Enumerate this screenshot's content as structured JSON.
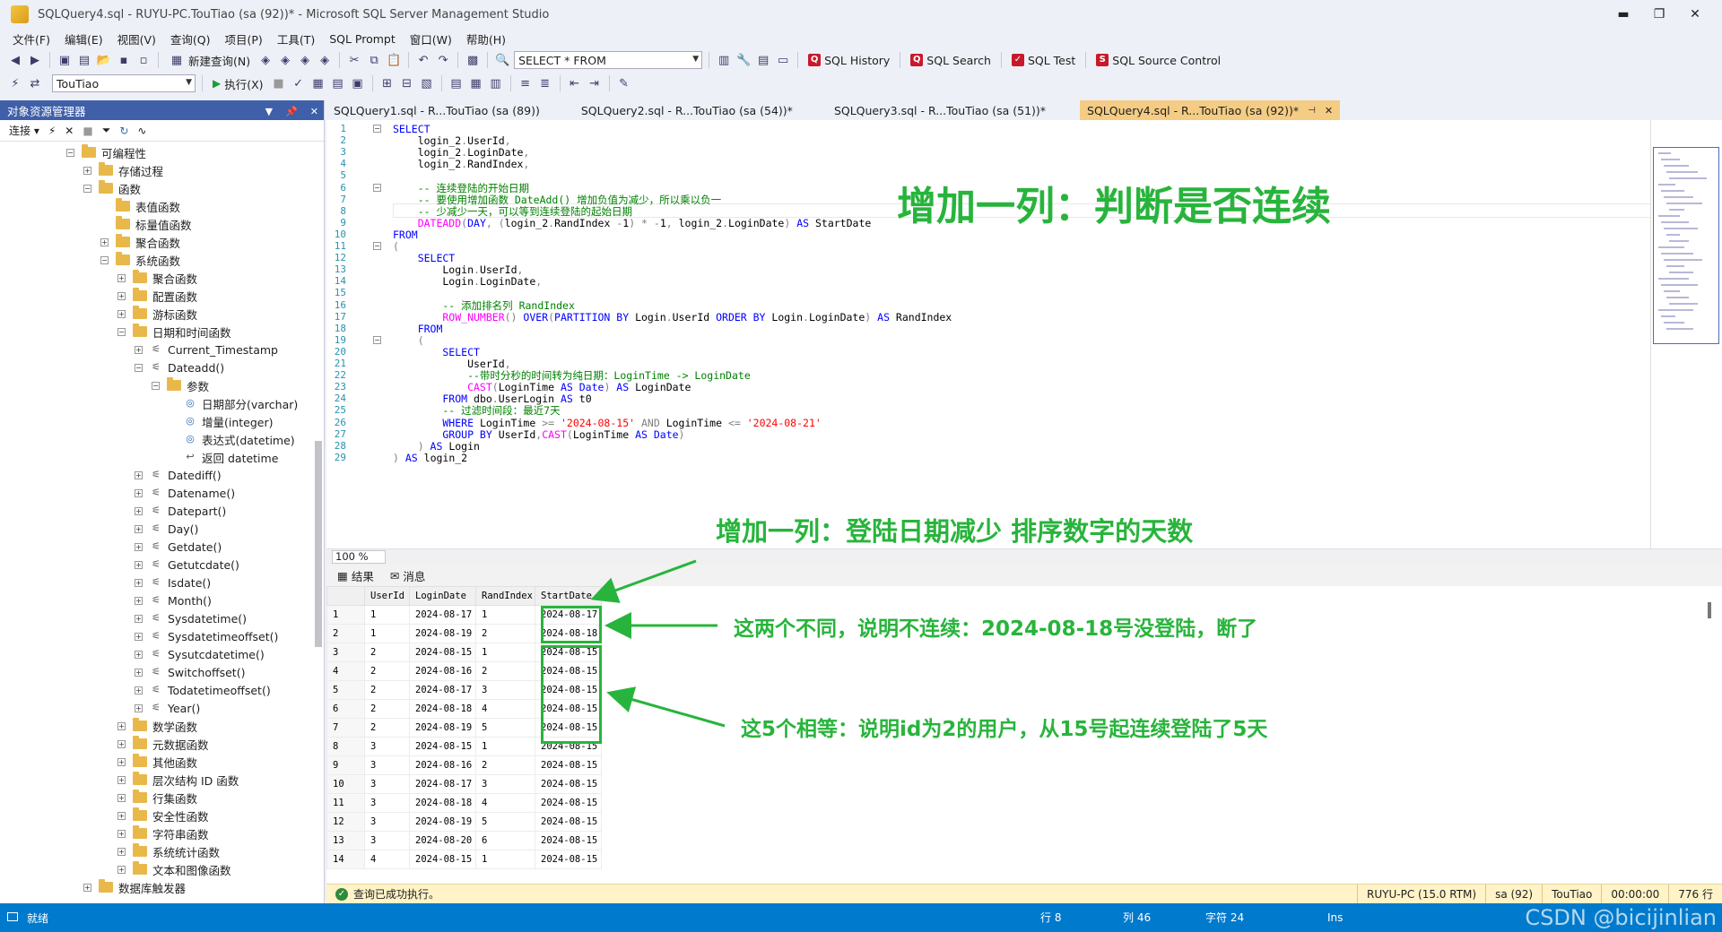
{
  "window": {
    "title": "SQLQuery4.sql - RUYU-PC.TouTiao (sa (92))* - Microsoft SQL Server Management Studio",
    "min": "▬",
    "max": "❐",
    "close": "✕"
  },
  "menu": [
    "文件(F)",
    "编辑(E)",
    "视图(V)",
    "查询(Q)",
    "项目(P)",
    "工具(T)",
    "SQL Prompt",
    "窗口(W)",
    "帮助(H)"
  ],
  "toolbar1": {
    "new_query": "新建查询(N)",
    "select_combo": "SELECT * FROM",
    "sql_history": "SQL History",
    "sql_search": "SQL Search",
    "sql_test": "SQL Test",
    "sql_source_control": "SQL Source Control"
  },
  "toolbar2": {
    "database": "TouTiao",
    "execute": "执行(X)"
  },
  "object_explorer": {
    "title": "对象资源管理器",
    "connect": "连接",
    "nodes": [
      {
        "label": "可编程性",
        "exp": "⊟",
        "type": "folder"
      },
      {
        "label": "存储过程",
        "exp": "⊞",
        "type": "folder"
      },
      {
        "label": "函数",
        "exp": "⊟",
        "type": "folder"
      },
      {
        "label": "表值函数",
        "exp": "",
        "type": "folder"
      },
      {
        "label": "标量值函数",
        "exp": "",
        "type": "folder"
      },
      {
        "label": "聚合函数",
        "exp": "⊞",
        "type": "folder"
      },
      {
        "label": "系统函数",
        "exp": "⊟",
        "type": "folder"
      },
      {
        "label": "聚合函数",
        "exp": "⊞",
        "type": "folder"
      },
      {
        "label": "配置函数",
        "exp": "⊞",
        "type": "folder"
      },
      {
        "label": "游标函数",
        "exp": "⊞",
        "type": "folder"
      },
      {
        "label": "日期和时间函数",
        "exp": "⊟",
        "type": "folder"
      },
      {
        "label": "Current_Timestamp",
        "exp": "⊞",
        "type": "fn"
      },
      {
        "label": "Dateadd()",
        "exp": "⊟",
        "type": "fn"
      },
      {
        "label": "参数",
        "exp": "⊟",
        "type": "folder"
      },
      {
        "label": "日期部分(varchar)",
        "exp": "",
        "type": "param"
      },
      {
        "label": "增量(integer)",
        "exp": "",
        "type": "param"
      },
      {
        "label": "表达式(datetime)",
        "exp": "",
        "type": "param"
      },
      {
        "label": "返回 datetime",
        "exp": "",
        "type": "ret"
      },
      {
        "label": "Datediff()",
        "exp": "⊞",
        "type": "fn"
      },
      {
        "label": "Datename()",
        "exp": "⊞",
        "type": "fn"
      },
      {
        "label": "Datepart()",
        "exp": "⊞",
        "type": "fn"
      },
      {
        "label": "Day()",
        "exp": "⊞",
        "type": "fn"
      },
      {
        "label": "Getdate()",
        "exp": "⊞",
        "type": "fn"
      },
      {
        "label": "Getutcdate()",
        "exp": "⊞",
        "type": "fn"
      },
      {
        "label": "Isdate()",
        "exp": "⊞",
        "type": "fn"
      },
      {
        "label": "Month()",
        "exp": "⊞",
        "type": "fn"
      },
      {
        "label": "Sysdatetime()",
        "exp": "⊞",
        "type": "fn"
      },
      {
        "label": "Sysdatetimeoffset()",
        "exp": "⊞",
        "type": "fn"
      },
      {
        "label": "Sysutcdatetime()",
        "exp": "⊞",
        "type": "fn"
      },
      {
        "label": "Switchoffset()",
        "exp": "⊞",
        "type": "fn"
      },
      {
        "label": "Todatetimeoffset()",
        "exp": "⊞",
        "type": "fn"
      },
      {
        "label": "Year()",
        "exp": "⊞",
        "type": "fn"
      },
      {
        "label": "数学函数",
        "exp": "⊞",
        "type": "folder"
      },
      {
        "label": "元数据函数",
        "exp": "⊞",
        "type": "folder"
      },
      {
        "label": "其他函数",
        "exp": "⊞",
        "type": "folder"
      },
      {
        "label": "层次结构 ID 函数",
        "exp": "⊞",
        "type": "folder"
      },
      {
        "label": "行集函数",
        "exp": "⊞",
        "type": "folder"
      },
      {
        "label": "安全性函数",
        "exp": "⊞",
        "type": "folder"
      },
      {
        "label": "字符串函数",
        "exp": "⊞",
        "type": "folder"
      },
      {
        "label": "系统统计函数",
        "exp": "⊞",
        "type": "folder"
      },
      {
        "label": "文本和图像函数",
        "exp": "⊞",
        "type": "folder"
      },
      {
        "label": "数据库触发器",
        "exp": "⊞",
        "type": "folder"
      }
    ]
  },
  "tabs": [
    {
      "label": "SQLQuery1.sql - R...TouTiao (sa (89))",
      "active": false
    },
    {
      "label": "SQLQuery2.sql - R...TouTiao (sa (54))*",
      "active": false
    },
    {
      "label": "SQLQuery3.sql - R...TouTiao (sa (51))*",
      "active": false
    },
    {
      "label": "SQLQuery4.sql - R...TouTiao (sa (92))*",
      "active": true
    }
  ],
  "code_lines": [
    [
      [
        "kw",
        "SELECT"
      ]
    ],
    [
      [
        "tx",
        "    login_2"
      ],
      [
        "gr",
        "."
      ],
      [
        "tx",
        "UserId"
      ],
      [
        "gr",
        ","
      ]
    ],
    [
      [
        "tx",
        "    login_2"
      ],
      [
        "gr",
        "."
      ],
      [
        "tx",
        "LoginDate"
      ],
      [
        "gr",
        ","
      ]
    ],
    [
      [
        "tx",
        "    login_2"
      ],
      [
        "gr",
        "."
      ],
      [
        "tx",
        "RandIndex"
      ],
      [
        "gr",
        ","
      ]
    ],
    [],
    [
      [
        "cm",
        "    -- 连续登陆的开始日期"
      ]
    ],
    [
      [
        "cm",
        "    -- 要使用增加函数 DateAdd() 增加负值为减少，所以乘以负一"
      ]
    ],
    [
      [
        "cm",
        "    -- 少减少一天，可以等到连续登陆的起始日期"
      ]
    ],
    [
      [
        "fnc",
        "    DATEADD"
      ],
      [
        "gr",
        "("
      ],
      [
        "kw",
        "DAY"
      ],
      [
        "gr",
        ", ("
      ],
      [
        "tx",
        "login_2"
      ],
      [
        "gr",
        "."
      ],
      [
        "tx",
        "RandIndex "
      ],
      [
        "gr",
        "-"
      ],
      [
        "tx",
        "1"
      ],
      [
        "gr",
        ") * -"
      ],
      [
        "tx",
        "1"
      ],
      [
        "gr",
        ", "
      ],
      [
        "tx",
        "login_2"
      ],
      [
        "gr",
        "."
      ],
      [
        "tx",
        "LoginDate"
      ],
      [
        "gr",
        ") "
      ],
      [
        "kw",
        "AS"
      ],
      [
        "tx",
        " StartDate"
      ]
    ],
    [
      [
        "kw",
        "FROM"
      ]
    ],
    [
      [
        "gr",
        "("
      ]
    ],
    [
      [
        "kw",
        "    SELECT"
      ]
    ],
    [
      [
        "tx",
        "        Login"
      ],
      [
        "gr",
        "."
      ],
      [
        "tx",
        "UserId"
      ],
      [
        "gr",
        ","
      ]
    ],
    [
      [
        "tx",
        "        Login"
      ],
      [
        "gr",
        "."
      ],
      [
        "tx",
        "LoginDate"
      ],
      [
        "gr",
        ","
      ]
    ],
    [],
    [
      [
        "cm",
        "        -- 添加排名列 RandIndex"
      ]
    ],
    [
      [
        "fnc",
        "        ROW_NUMBER"
      ],
      [
        "gr",
        "() "
      ],
      [
        "kw",
        "OVER"
      ],
      [
        "gr",
        "("
      ],
      [
        "kw",
        "PARTITION BY"
      ],
      [
        "tx",
        " Login"
      ],
      [
        "gr",
        "."
      ],
      [
        "tx",
        "UserId "
      ],
      [
        "kw",
        "ORDER BY"
      ],
      [
        "tx",
        " Login"
      ],
      [
        "gr",
        "."
      ],
      [
        "tx",
        "LoginDate"
      ],
      [
        "gr",
        ") "
      ],
      [
        "kw",
        "AS"
      ],
      [
        "tx",
        " RandIndex"
      ]
    ],
    [
      [
        "kw",
        "    FROM"
      ]
    ],
    [
      [
        "gr",
        "    ("
      ]
    ],
    [
      [
        "kw",
        "        SELECT"
      ]
    ],
    [
      [
        "tx",
        "            UserId"
      ],
      [
        "gr",
        ","
      ]
    ],
    [
      [
        "cm",
        "            --带时分秒的时间转为纯日期：LoginTime -> LoginDate"
      ]
    ],
    [
      [
        "fnc",
        "            CAST"
      ],
      [
        "gr",
        "("
      ],
      [
        "tx",
        "LoginTime "
      ],
      [
        "kw",
        "AS Date"
      ],
      [
        "gr",
        ") "
      ],
      [
        "kw",
        "AS"
      ],
      [
        "tx",
        " LoginDate"
      ]
    ],
    [
      [
        "kw",
        "        FROM"
      ],
      [
        "tx",
        " dbo"
      ],
      [
        "gr",
        "."
      ],
      [
        "tx",
        "UserLogin "
      ],
      [
        "kw",
        "AS"
      ],
      [
        "tx",
        " t0"
      ]
    ],
    [
      [
        "cm",
        "        -- 过滤时间段：最近7天"
      ]
    ],
    [
      [
        "kw",
        "        WHERE"
      ],
      [
        "tx",
        " LoginTime "
      ],
      [
        "gr",
        ">="
      ],
      [
        "str",
        " '2024-08-15'"
      ],
      [
        "gr",
        " AND"
      ],
      [
        "tx",
        " LoginTime "
      ],
      [
        "gr",
        "<="
      ],
      [
        "str",
        " '2024-08-21'"
      ]
    ],
    [
      [
        "kw",
        "        GROUP BY"
      ],
      [
        "tx",
        " UserId"
      ],
      [
        "gr",
        ","
      ],
      [
        "fnc",
        "CAST"
      ],
      [
        "gr",
        "("
      ],
      [
        "tx",
        "LoginTime "
      ],
      [
        "kw",
        "AS Date"
      ],
      [
        "gr",
        ")"
      ]
    ],
    [
      [
        "gr",
        "    ) "
      ],
      [
        "kw",
        "AS"
      ],
      [
        "tx",
        " Login"
      ]
    ],
    [
      [
        "gr",
        ") "
      ],
      [
        "kw",
        "AS"
      ],
      [
        "tx",
        " login_2"
      ]
    ]
  ],
  "annotations": {
    "a1": "增加一列：判断是否连续",
    "a2": "增加一列：登陆日期减少 排序数字的天数",
    "a3": "这两个不同，说明不连续：2024-08-18号没登陆，断了",
    "a4": "这5个相等：说明id为2的用户，从15号起连续登陆了5天"
  },
  "zoom": "100 %",
  "results_tabs": {
    "results": "结果",
    "messages": "消息"
  },
  "grid": {
    "columns": [
      "UserId",
      "LoginDate",
      "RandIndex",
      "StartDate"
    ],
    "rows": [
      [
        "1",
        "1",
        "2024-08-17",
        "1",
        "2024-08-17"
      ],
      [
        "2",
        "1",
        "2024-08-19",
        "2",
        "2024-08-18"
      ],
      [
        "3",
        "2",
        "2024-08-15",
        "1",
        "2024-08-15"
      ],
      [
        "4",
        "2",
        "2024-08-16",
        "2",
        "2024-08-15"
      ],
      [
        "5",
        "2",
        "2024-08-17",
        "3",
        "2024-08-15"
      ],
      [
        "6",
        "2",
        "2024-08-18",
        "4",
        "2024-08-15"
      ],
      [
        "7",
        "2",
        "2024-08-19",
        "5",
        "2024-08-15"
      ],
      [
        "8",
        "3",
        "2024-08-15",
        "1",
        "2024-08-15"
      ],
      [
        "9",
        "3",
        "2024-08-16",
        "2",
        "2024-08-15"
      ],
      [
        "10",
        "3",
        "2024-08-17",
        "3",
        "2024-08-15"
      ],
      [
        "11",
        "3",
        "2024-08-18",
        "4",
        "2024-08-15"
      ],
      [
        "12",
        "3",
        "2024-08-19",
        "5",
        "2024-08-15"
      ],
      [
        "13",
        "3",
        "2024-08-20",
        "6",
        "2024-08-15"
      ],
      [
        "14",
        "4",
        "2024-08-15",
        "1",
        "2024-08-15"
      ]
    ]
  },
  "exec_status": {
    "message": "查询已成功执行。",
    "server": "RUYU-PC (15.0 RTM)",
    "user": "sa (92)",
    "db": "TouTiao",
    "time": "00:00:00",
    "rows": "776 行"
  },
  "statusbar": {
    "ready": "就绪",
    "row": "行 8",
    "col": "列 46",
    "ch": "字符 24",
    "ins": "Ins",
    "watermark": "CSDN @bicijinlian"
  },
  "colors": {
    "accent": "#007acc",
    "annotation": "#28b43c",
    "active_tab": "#f5cc84"
  }
}
